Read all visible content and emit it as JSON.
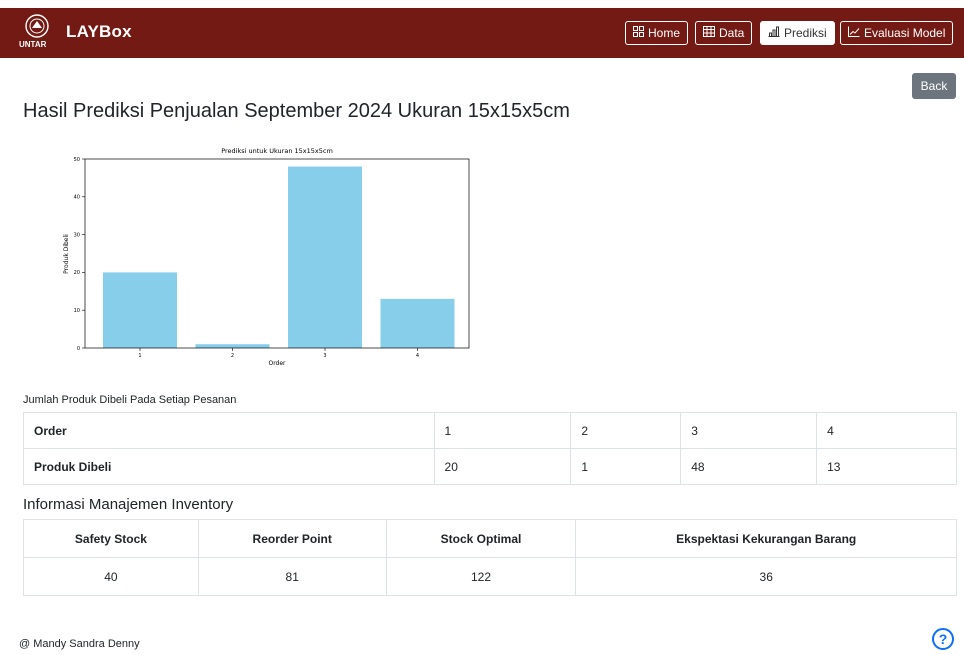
{
  "navbar": {
    "brand": "LAYBox",
    "logo_text": "UNTAR",
    "bg_color": "#731a14",
    "items": [
      {
        "label": "Home",
        "icon": "grid-icon",
        "active": false
      },
      {
        "label": "Data",
        "icon": "table-icon",
        "active": false
      },
      {
        "label": "Prediksi",
        "icon": "bar-chart-icon",
        "active": true
      },
      {
        "label": "Evaluasi Model",
        "icon": "line-chart-icon",
        "active": false
      }
    ]
  },
  "page": {
    "back_label": "Back",
    "title": "Hasil Prediksi Penjualan September 2024 Ukuran 15x15x5cm"
  },
  "chart_data": {
    "type": "bar",
    "title": "Prediksi untuk Ukuran 15x15x5cm",
    "xlabel": "Order",
    "ylabel": "Produk Dibeli",
    "categories": [
      "1",
      "2",
      "3",
      "4"
    ],
    "values": [
      20,
      1,
      48,
      13
    ],
    "ylim": [
      0,
      50
    ],
    "yticks": [
      0,
      10,
      20,
      30,
      40,
      50
    ],
    "bar_color": "#87ceeb",
    "grid": false
  },
  "order_table": {
    "caption": "Jumlah Produk Dibeli Pada Setiap Pesanan",
    "row1": {
      "header": "Order",
      "values": [
        "1",
        "2",
        "3",
        "4"
      ]
    },
    "row2": {
      "header": "Produk Dibeli",
      "values": [
        "20",
        "1",
        "48",
        "13"
      ]
    }
  },
  "inventory": {
    "title": "Informasi Manajemen Inventory",
    "headers": [
      "Safety Stock",
      "Reorder Point",
      "Stock Optimal",
      "Ekspektasi Kekurangan Barang"
    ],
    "values": [
      "40",
      "81",
      "122",
      "36"
    ]
  },
  "footer": {
    "text": "@ Mandy Sandra Denny",
    "help": "?"
  }
}
